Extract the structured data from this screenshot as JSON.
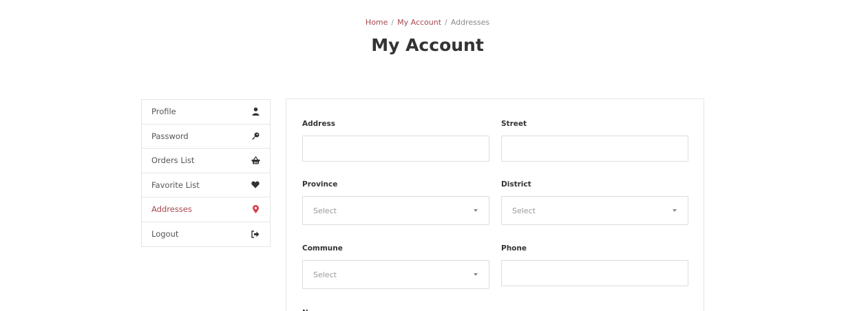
{
  "breadcrumb": {
    "home": "Home",
    "account": "My Account",
    "current": "Addresses",
    "separator": "/"
  },
  "page_title": "My Account",
  "sidebar": {
    "items": [
      {
        "label": "Profile",
        "icon": "user-icon"
      },
      {
        "label": "Password",
        "icon": "key-icon"
      },
      {
        "label": "Orders List",
        "icon": "basket-icon"
      },
      {
        "label": "Favorite List",
        "icon": "heart-icon"
      },
      {
        "label": "Addresses",
        "icon": "map-marker-icon",
        "active": true
      },
      {
        "label": "Logout",
        "icon": "sign-out-icon"
      }
    ]
  },
  "form": {
    "address": {
      "label": "Address",
      "value": ""
    },
    "street": {
      "label": "Street",
      "value": ""
    },
    "province": {
      "label": "Province",
      "selected": "Select"
    },
    "district": {
      "label": "District",
      "selected": "Select"
    },
    "commune": {
      "label": "Commune",
      "selected": "Select"
    },
    "phone": {
      "label": "Phone",
      "value": ""
    },
    "next_label_partial": "N"
  },
  "colors": {
    "accent": "#a6484f",
    "border": "#e5e5e5",
    "text": "#333333"
  }
}
